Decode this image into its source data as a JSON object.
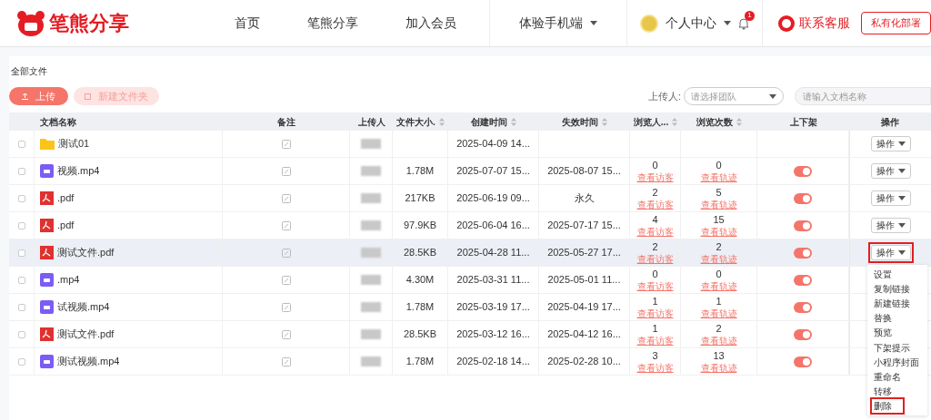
{
  "header": {
    "brand": "笔熊分享",
    "nav": [
      {
        "label": "首页",
        "dropdown": false
      },
      {
        "label": "笔熊分享",
        "dropdown": false
      },
      {
        "label": "加入会员",
        "dropdown": false
      },
      {
        "label": "体验手机端",
        "dropdown": true
      }
    ],
    "user": {
      "label": "个人中心",
      "badge": "1"
    },
    "support": "联系客服",
    "deploy_button": "私有化部署"
  },
  "breadcrumb": "全部文件",
  "toolbar": {
    "upload": "上传",
    "new_folder": "新建文件夹",
    "uploader_label": "上传人:",
    "uploader_placeholder": "请选择团队",
    "search_placeholder": "请输入文档名称"
  },
  "table": {
    "columns": [
      {
        "label": "文档名称",
        "sortable": false
      },
      {
        "label": "备注",
        "sortable": false
      },
      {
        "label": "上传人",
        "sortable": false
      },
      {
        "label": "文件大小.",
        "sortable": true
      },
      {
        "label": "创建时间",
        "sortable": true
      },
      {
        "label": "失效时间",
        "sortable": true
      },
      {
        "label": "浏览人...",
        "sortable": true
      },
      {
        "label": "浏览次数",
        "sortable": true
      },
      {
        "label": "上下架",
        "sortable": false
      },
      {
        "label": "操作",
        "sortable": false
      }
    ],
    "rows": [
      {
        "kind": "folder",
        "name": "测试01",
        "size": "",
        "created": "2025-04-09 14...",
        "expires": "",
        "viewers": "",
        "visits": "",
        "hover": false,
        "action": "操作",
        "action_highlighted": false
      },
      {
        "kind": "video",
        "name": "视频.mp4",
        "size": "1.78M",
        "created": "2025-07-07 15...",
        "expires": "2025-08-07 15...",
        "viewers": "0",
        "viewers_link": "查看访客",
        "visits": "0",
        "visits_link": "查看轨迹",
        "on": true,
        "hover": false,
        "action": "操作",
        "action_highlighted": false
      },
      {
        "kind": "pdf",
        "name": ".pdf",
        "size": "217KB",
        "created": "2025-06-19 09...",
        "expires": "永久",
        "viewers": "2",
        "viewers_link": "查看访客",
        "visits": "5",
        "visits_link": "查看轨迹",
        "on": true,
        "hover": false,
        "action": "操作",
        "action_highlighted": false
      },
      {
        "kind": "pdf",
        "name": ".pdf",
        "size": "97.9KB",
        "created": "2025-06-04 16...",
        "expires": "2025-07-17 15...",
        "viewers": "4",
        "viewers_link": "查看访客",
        "visits": "15",
        "visits_link": "查看轨迹",
        "on": true,
        "hover": false,
        "action": "操作",
        "action_highlighted": false
      },
      {
        "kind": "pdf",
        "name": "测试文件.pdf",
        "size": "28.5KB",
        "created": "2025-04-28 11...",
        "expires": "2025-05-27 17...",
        "viewers": "2",
        "viewers_link": "查看访客",
        "visits": "2",
        "visits_link": "查看轨迹",
        "on": true,
        "hover": true,
        "action": "操作",
        "action_highlighted": true
      },
      {
        "kind": "video",
        "name": ".mp4",
        "size": "4.30M",
        "created": "2025-03-31 11...",
        "expires": "2025-05-01 11...",
        "viewers": "0",
        "viewers_link": "查看访客",
        "visits": "0",
        "visits_link": "查看轨迹",
        "on": true,
        "hover": false
      },
      {
        "kind": "video",
        "name": "试视频.mp4",
        "size": "1.78M",
        "created": "2025-03-19 17...",
        "expires": "2025-04-19 17...",
        "viewers": "1",
        "viewers_link": "查看访客",
        "visits": "1",
        "visits_link": "查看轨迹",
        "on": true,
        "hover": false
      },
      {
        "kind": "pdf",
        "name": "测试文件.pdf",
        "size": "28.5KB",
        "created": "2025-03-12 16...",
        "expires": "2025-04-12 16...",
        "viewers": "1",
        "viewers_link": "查看访客",
        "visits": "2",
        "visits_link": "查看轨迹",
        "on": true,
        "hover": false
      },
      {
        "kind": "video",
        "name": "测试视频.mp4",
        "size": "1.78M",
        "created": "2025-02-18 14...",
        "expires": "2025-02-28 10...",
        "viewers": "3",
        "viewers_link": "查看访客",
        "visits": "13",
        "visits_link": "查看轨迹",
        "on": true,
        "hover": false
      }
    ]
  },
  "action_menu": [
    {
      "label": "设置",
      "highlighted": false
    },
    {
      "label": "复制链接",
      "highlighted": false
    },
    {
      "label": "新建链接",
      "highlighted": false
    },
    {
      "label": "替换",
      "highlighted": false
    },
    {
      "label": "预览",
      "highlighted": false
    },
    {
      "label": "下架提示",
      "highlighted": false
    },
    {
      "label": "小程序封面",
      "highlighted": false
    },
    {
      "label": "重命名",
      "highlighted": false
    },
    {
      "label": "转移",
      "highlighted": false
    },
    {
      "label": "删除",
      "highlighted": true
    }
  ]
}
